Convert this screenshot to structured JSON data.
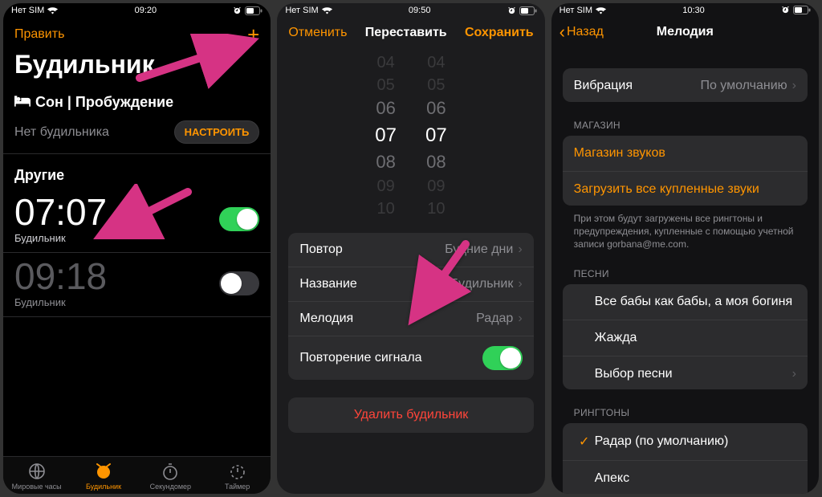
{
  "screen1": {
    "status": {
      "carrier": "Нет SIM",
      "time": "09:20"
    },
    "edit": "Править",
    "title": "Будильник",
    "sleep_section": "Сон | Пробуждение",
    "no_alarm": "Нет будильника",
    "setup": "НАСТРОИТЬ",
    "others": "Другие",
    "alarms": [
      {
        "time": "07:07",
        "label": "Будильник",
        "on": true
      },
      {
        "time": "09:18",
        "label": "Будильник",
        "on": false
      }
    ],
    "tabs": {
      "world": "Мировые часы",
      "alarm": "Будильник",
      "stopwatch": "Секундомер",
      "timer": "Таймер"
    }
  },
  "screen2": {
    "status": {
      "carrier": "Нет SIM",
      "time": "09:50"
    },
    "cancel": "Отменить",
    "title": "Переставить",
    "save": "Сохранить",
    "picker": {
      "hours": [
        "04",
        "05",
        "06",
        "07",
        "08",
        "09",
        "10"
      ],
      "minutes": [
        "04",
        "05",
        "06",
        "07",
        "08",
        "09",
        "10"
      ]
    },
    "rows": {
      "repeat_label": "Повтор",
      "repeat_value": "Будние дни",
      "name_label": "Название",
      "name_value": "Будильник",
      "sound_label": "Мелодия",
      "sound_value": "Радар",
      "snooze_label": "Повторение сигнала"
    },
    "delete": "Удалить будильник"
  },
  "screen3": {
    "status": {
      "carrier": "Нет SIM",
      "time": "10:30"
    },
    "back": "Назад",
    "title": "Мелодия",
    "vibration_label": "Вибрация",
    "vibration_value": "По умолчанию",
    "store_header": "МАГАЗИН",
    "store_row": "Магазин звуков",
    "download_row": "Загрузить все купленные звуки",
    "store_footer": "При этом будут загружены все рингтоны и предупреждения, купленные с помощью учетной записи gorbana@me.com.",
    "songs_header": "ПЕСНИ",
    "songs": [
      "Все бабы как бабы, а моя богиня",
      "Жажда"
    ],
    "pick_song": "Выбор песни",
    "ringtones_header": "РИНГТОНЫ",
    "ringtone_selected": "Радар (по умолчанию)",
    "ringtone_next": "Апекс"
  }
}
